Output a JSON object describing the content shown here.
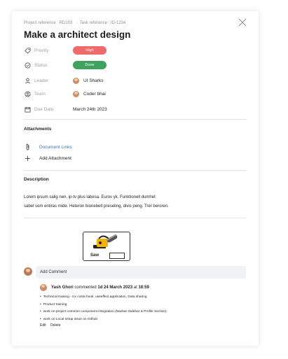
{
  "header": {
    "project_ref": "Project reference : RD103",
    "task_ref": "Task reference : ID-1234",
    "title": "Make a architect design"
  },
  "props": {
    "priority": {
      "label": "Priority",
      "value": "High"
    },
    "status": {
      "label": "Status",
      "value": "Done"
    },
    "leader": {
      "label": "Leader",
      "value": "UI Sharks"
    },
    "team": {
      "label": "Team",
      "value": "Coder bhai"
    },
    "due_date": {
      "label": "Due Date",
      "value": "March 24th 2023"
    }
  },
  "attachments": {
    "heading": "Attachments",
    "link_label": "Document Links",
    "add_label": "Add Attachment"
  },
  "description": {
    "heading": "Description",
    "line1": "Lorem ipsum salig nen, ip-tv plus labesa. Eurov yk. Funktionell dumhet",
    "line2": "sabel som entiras mide. Heteron bionebelt preseling, divis peng. Trer beroren."
  },
  "image": {
    "label": "Saw"
  },
  "comments": {
    "placeholder": "Add Comment",
    "author": "Yash Ghori",
    "commented_on": "commented",
    "timestamp": "1d 24 March 2023",
    "at": "at",
    "time": "18:59",
    "items": [
      "Technical training - Ux costa hook, useeffect,applicaiton, Data sharing",
      "Product training",
      "work on project common component integration (Navbar-Sidebar & Profile Section)",
      "work on Local setup issue on Github"
    ],
    "edit": "Edit",
    "delete": "Delete"
  },
  "colors": {
    "high": "#ee6b6b",
    "done": "#3fa35f",
    "link": "#3673b8"
  }
}
